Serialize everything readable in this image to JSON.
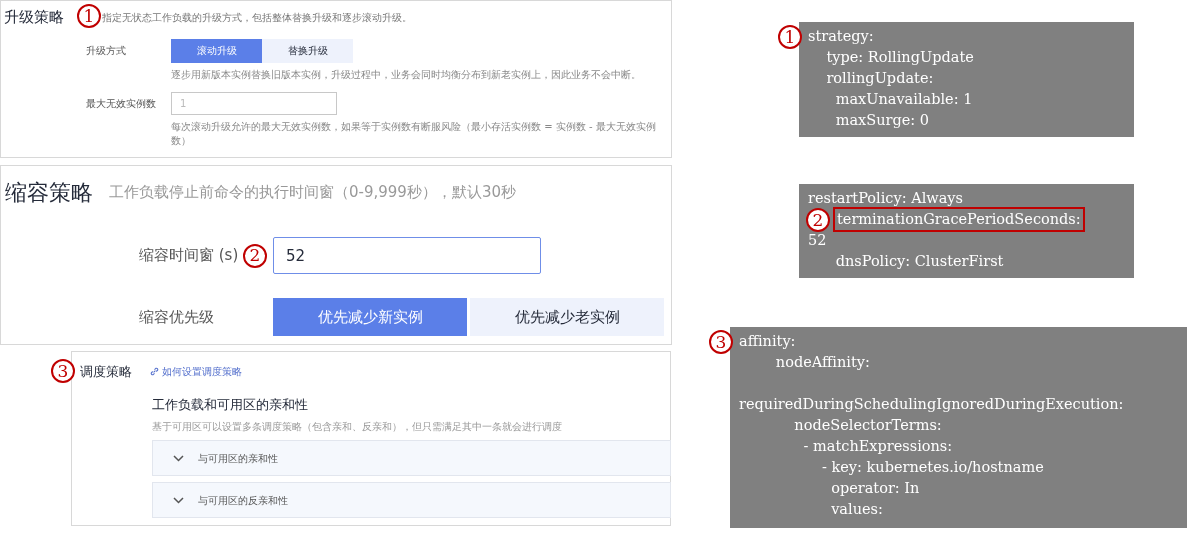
{
  "panels": [
    {
      "kind": "upgrade",
      "badge": "1",
      "title": "升级策略",
      "description": "指定无状态工作负载的升级方式，包括整体替换升级和逐步滚动升级。",
      "mode": {
        "label": "升级方式",
        "options": [
          {
            "label": "滚动升级",
            "selected": true
          },
          {
            "label": "替换升级",
            "selected": false
          }
        ],
        "hint": "逐步用新版本实例替换旧版本实例，升级过程中，业务会同时均衡分布到新老实例上，因此业务不会中断。"
      },
      "max_unavailable": {
        "label": "最大无效实例数",
        "placeholder": "1",
        "hint": "每次滚动升级允许的最大无效实例数，如果等于实例数有断服风险（最小存活实例数 = 实例数 - 最大无效实例数）"
      }
    },
    {
      "kind": "scale_down",
      "badge": "2",
      "title": "缩容策略",
      "description": "工作负载停止前命令的执行时间窗（0-9,999秒），默认30秒",
      "window": {
        "label": "缩容时间窗 (s)",
        "value": "52"
      },
      "priority": {
        "label": "缩容优先级",
        "options": [
          {
            "label": "优先减少新实例",
            "selected": true
          },
          {
            "label": "优先减少老实例",
            "selected": false
          }
        ]
      }
    },
    {
      "kind": "scheduling",
      "badge": "3",
      "title": "调度策略",
      "link": "如何设置调度策略",
      "section_title": "工作负载和可用区的亲和性",
      "section_description": "基于可用区可以设置多条调度策略（包含亲和、反亲和），但只需满足其中一条就会进行调度",
      "groups": [
        {
          "label": "与可用区的亲和性",
          "expanded": false
        },
        {
          "label": "与可用区的反亲和性",
          "expanded": false
        }
      ]
    }
  ],
  "code_blocks": [
    {
      "badge": "1",
      "lines": [
        {
          "text": "strategy:",
          "highlighted": false
        },
        {
          "text": "    type: RollingUpdate",
          "highlighted": false
        },
        {
          "text": "    rollingUpdate:",
          "highlighted": false
        },
        {
          "text": "      maxUnavailable: 1",
          "highlighted": false
        },
        {
          "text": "      maxSurge: 0",
          "highlighted": false
        }
      ]
    },
    {
      "badge": "2",
      "lines": [
        {
          "text": "restartPolicy: Always",
          "highlighted": false
        },
        {
          "text": "terminationGracePeriodSeconds:",
          "highlighted": true
        },
        {
          "text": "52",
          "highlighted": false
        },
        {
          "text": "      dnsPolicy: ClusterFirst",
          "highlighted": false
        }
      ]
    },
    {
      "badge": "3",
      "lines": [
        {
          "text": "affinity:",
          "highlighted": false
        },
        {
          "text": "        nodeAffinity:",
          "highlighted": false
        },
        {
          "text": "requiredDuringSchedulingIgnoredDuringExecution:",
          "highlighted": false,
          "spaced_before": true
        },
        {
          "text": "            nodeSelectorTerms:",
          "highlighted": false
        },
        {
          "text": "              - matchExpressions:",
          "highlighted": false
        },
        {
          "text": "                  - key: kubernetes.io/hostname",
          "highlighted": false
        },
        {
          "text": "                    operator: In",
          "highlighted": false
        },
        {
          "text": "                    values:",
          "highlighted": false
        }
      ]
    }
  ]
}
